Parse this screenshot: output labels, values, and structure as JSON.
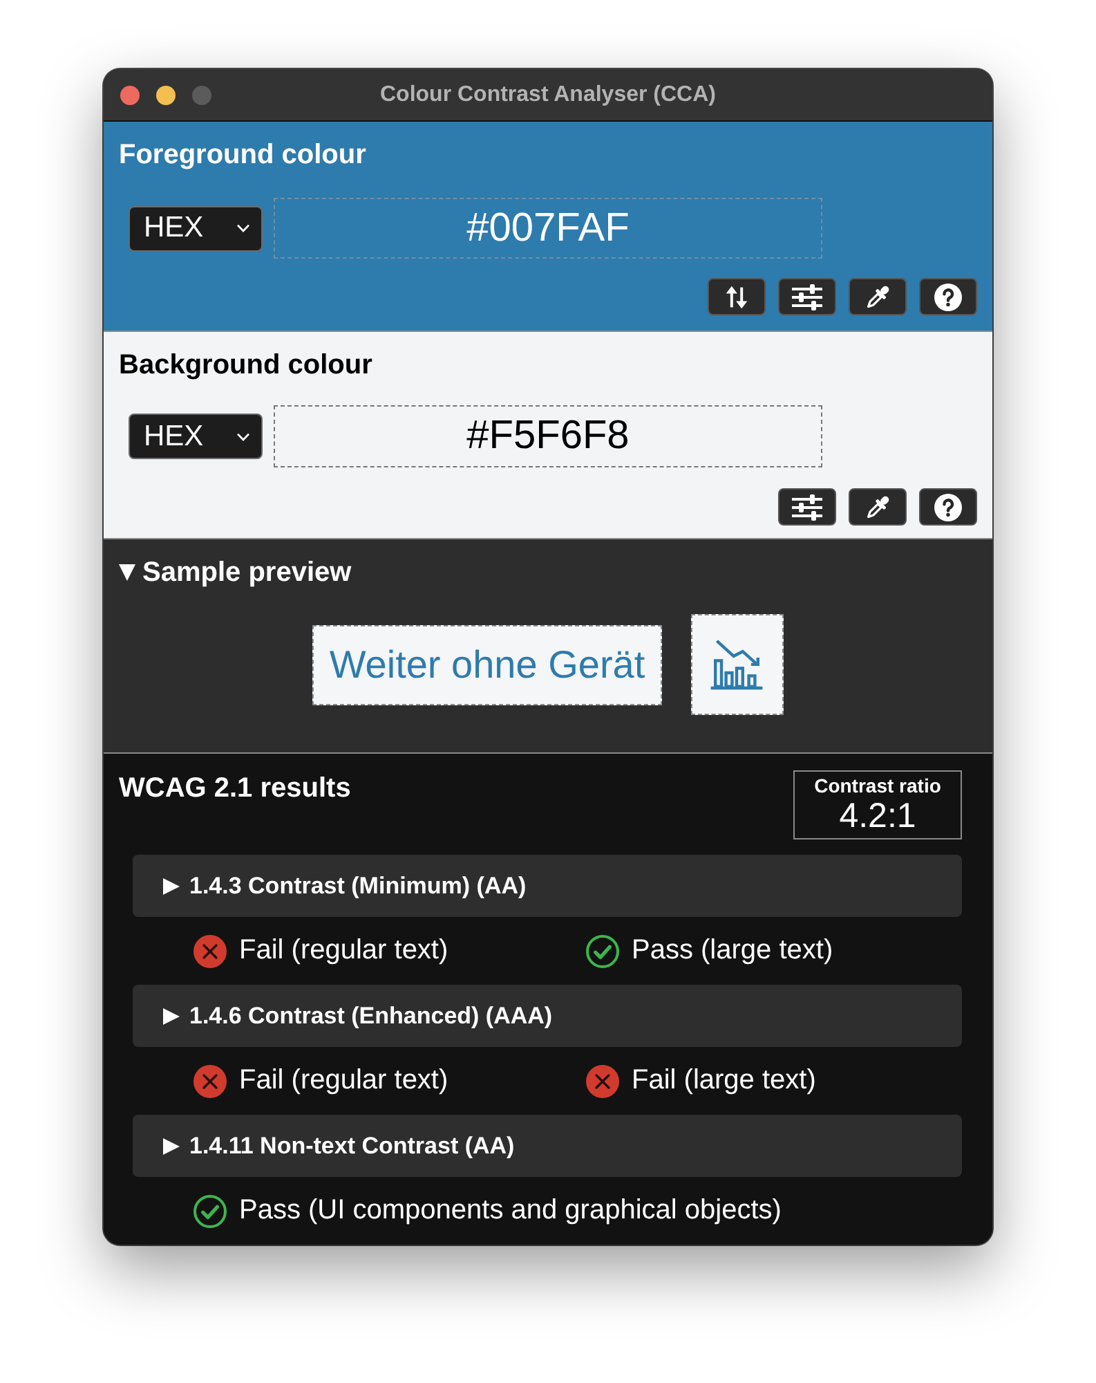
{
  "window": {
    "title": "Colour Contrast Analyser (CCA)",
    "controls": [
      {
        "kind": "close",
        "disabled": false
      },
      {
        "kind": "minimize",
        "disabled": false
      },
      {
        "kind": "zoom",
        "disabled": true
      }
    ]
  },
  "foreground": {
    "heading": "Foreground colour",
    "format": "HEX",
    "value": "#007FAF",
    "tools": [
      {
        "kind": "swap"
      },
      {
        "kind": "sliders"
      },
      {
        "kind": "eyedropper"
      },
      {
        "kind": "help"
      }
    ]
  },
  "background": {
    "heading": "Background colour",
    "format": "HEX",
    "value": "#F5F6F8",
    "tools": [
      {
        "kind": "sliders"
      },
      {
        "kind": "eyedropper"
      },
      {
        "kind": "help"
      }
    ]
  },
  "sample_preview": {
    "title": "Sample preview",
    "expanded": true,
    "sample_text": "Weiter ohne Gerät"
  },
  "results": {
    "title": "WCAG 2.1 results",
    "ratio_label": "Contrast ratio",
    "ratio": "4.2:1",
    "criteria": [
      {
        "title": "1.4.3 Contrast (Minimum) (AA)",
        "expanded": false,
        "outcomes": [
          {
            "text": "Fail (regular text)",
            "passed": false
          },
          {
            "text": "Pass (large text)",
            "passed": true
          }
        ]
      },
      {
        "title": "1.4.6 Contrast (Enhanced) (AAA)",
        "expanded": false,
        "outcomes": [
          {
            "text": "Fail (regular text)",
            "passed": false
          },
          {
            "text": "Fail (large text)",
            "passed": false
          }
        ]
      },
      {
        "title": "1.4.11 Non-text Contrast (AA)",
        "expanded": false,
        "outcomes": [
          {
            "text": "Pass (UI components and graphical objects)",
            "passed": true
          }
        ]
      }
    ]
  }
}
